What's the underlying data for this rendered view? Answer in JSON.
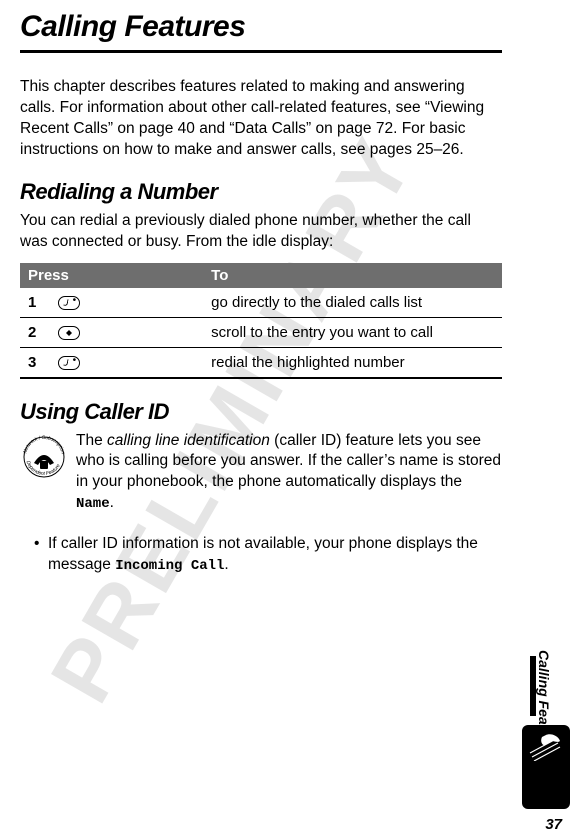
{
  "watermark": "PRELIMINARY",
  "chapter_title": "Calling Features",
  "intro": "This chapter describes features related to making and answering calls. For information about other call-related features, see “Viewing Recent Calls” on page 40 and “Data Calls” on page 72. For basic instructions on how to make and answer calls, see pages 25–26.",
  "sections": {
    "redial": {
      "heading": "Redialing a Number",
      "body": "You can redial a previously dialed phone number, whether the call was connected or busy. From the idle display:"
    },
    "caller_id": {
      "heading": "Using Caller ID",
      "body_prefix": "The ",
      "body_italic": "calling line identification",
      "body_mid": " (caller ID) feature lets you see who is calling before you answer. If the caller’s name is stored in your phonebook, the phone automatically displays the ",
      "body_label": "Name",
      "body_suffix": ".",
      "bullet_prefix": "If caller ID information is not available, your phone displays the message ",
      "bullet_label": "Incoming Call",
      "bullet_suffix": "."
    }
  },
  "table": {
    "head_press": "Press",
    "head_to": "To",
    "rows": [
      {
        "num": "1",
        "key": "send",
        "desc": "go directly to the dialed calls list"
      },
      {
        "num": "2",
        "key": "scroll",
        "desc": "scroll to the entry you want to call"
      },
      {
        "num": "3",
        "key": "send",
        "desc": "redial the highlighted number"
      }
    ]
  },
  "side_tab": "Calling Features",
  "page_number": "37"
}
